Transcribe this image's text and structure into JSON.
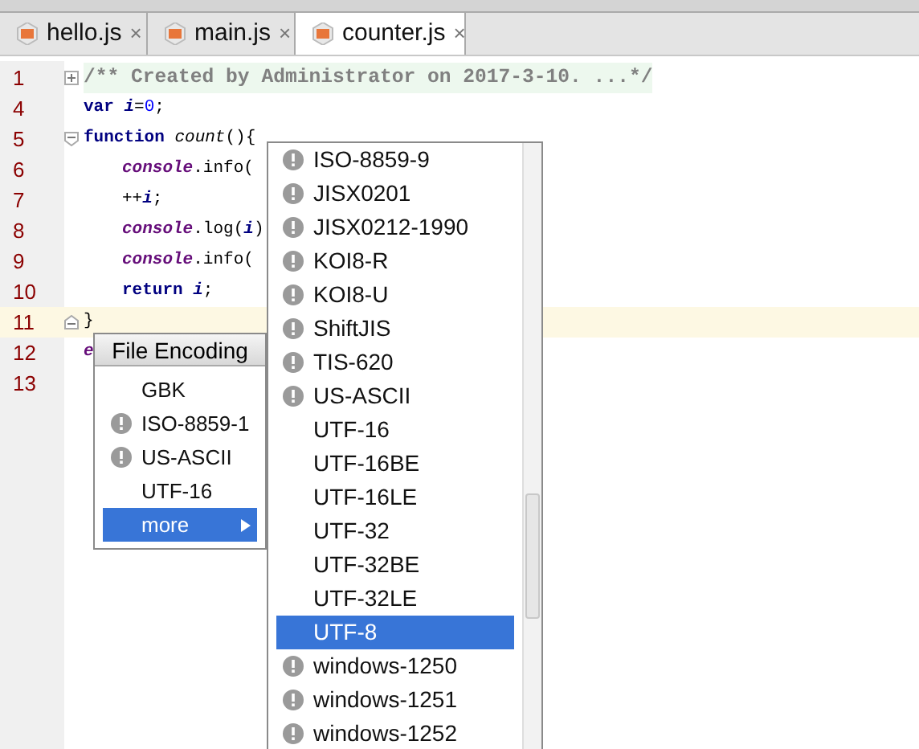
{
  "tabs": [
    {
      "label": "hello.js",
      "close": "×",
      "selected": false
    },
    {
      "label": "main.js",
      "close": "×",
      "selected": false
    },
    {
      "label": "counter.js",
      "close": "×",
      "selected": true
    }
  ],
  "code_lines": [
    {
      "number": "1",
      "kind": "fold-start",
      "highlighted": false,
      "tokens": [
        {
          "kind": "comment",
          "text": "/** Created by Administrator on 2017-3-10. ...*/"
        }
      ]
    },
    {
      "number": "4",
      "kind": "plain",
      "highlighted": false,
      "tokens": [
        {
          "kind": "keyword",
          "text": "var "
        },
        {
          "kind": "variable",
          "text": "i"
        },
        {
          "kind": "plain",
          "text": "="
        },
        {
          "kind": "number",
          "text": "0"
        },
        {
          "kind": "plain",
          "text": ";"
        }
      ]
    },
    {
      "number": "5",
      "kind": "fold-open",
      "highlighted": false,
      "tokens": [
        {
          "kind": "keyword",
          "text": "function "
        },
        {
          "kind": "function",
          "text": "count"
        },
        {
          "kind": "plain",
          "text": "(){"
        }
      ],
      "children": [
        {
          "number": "6",
          "kind": "plain",
          "highlighted": false,
          "tokens": [
            {
              "kind": "global",
              "text": "console"
            },
            {
              "kind": "plain",
              "text": ".info("
            }
          ]
        },
        {
          "number": "7",
          "kind": "plain",
          "highlighted": false,
          "tokens": [
            {
              "kind": "plain",
              "text": "++"
            },
            {
              "kind": "variable",
              "text": "i"
            },
            {
              "kind": "plain",
              "text": ";"
            }
          ]
        },
        {
          "number": "8",
          "kind": "plain",
          "highlighted": false,
          "tokens": [
            {
              "kind": "global",
              "text": "console"
            },
            {
              "kind": "plain",
              "text": ".log("
            },
            {
              "kind": "variable",
              "text": "i"
            },
            {
              "kind": "plain",
              "text": ")"
            }
          ]
        },
        {
          "number": "9",
          "kind": "plain",
          "highlighted": false,
          "tokens": [
            {
              "kind": "global",
              "text": "console"
            },
            {
              "kind": "plain",
              "text": ".info("
            }
          ]
        },
        {
          "number": "10",
          "kind": "plain",
          "highlighted": false,
          "tokens": [
            {
              "kind": "keyword",
              "text": "return "
            },
            {
              "kind": "variable",
              "text": "i"
            },
            {
              "kind": "plain",
              "text": ";"
            }
          ]
        }
      ]
    },
    {
      "number": "11",
      "kind": "fold-end",
      "highlighted": true,
      "tokens": [
        {
          "kind": "plain",
          "text": "}"
        }
      ]
    },
    {
      "number": "12",
      "kind": "plain",
      "highlighted": false,
      "tokens": [
        {
          "kind": "global",
          "text": "e"
        }
      ]
    },
    {
      "number": "13",
      "kind": "plain",
      "highlighted": false
    }
  ],
  "file_encoding_popup": {
    "title": "File Encoding",
    "items": [
      {
        "label": "GBK",
        "warning": false,
        "selected": false,
        "submenu": false
      },
      {
        "label": "ISO-8859-1",
        "warning": true,
        "selected": false,
        "submenu": false
      },
      {
        "label": "US-ASCII",
        "warning": true,
        "selected": false,
        "submenu": false
      },
      {
        "label": "UTF-16",
        "warning": false,
        "selected": false,
        "submenu": false
      },
      {
        "label": "more",
        "warning": false,
        "selected": true,
        "submenu": true
      }
    ]
  },
  "more_list": {
    "items": [
      {
        "label": "ISO-8859-9",
        "warning": true,
        "selected": false
      },
      {
        "label": "JISX0201",
        "warning": true,
        "selected": false
      },
      {
        "label": "JISX0212-1990",
        "warning": true,
        "selected": false
      },
      {
        "label": "KOI8-R",
        "warning": true,
        "selected": false
      },
      {
        "label": "KOI8-U",
        "warning": true,
        "selected": false
      },
      {
        "label": "ShiftJIS",
        "warning": true,
        "selected": false
      },
      {
        "label": "TIS-620",
        "warning": true,
        "selected": false
      },
      {
        "label": "US-ASCII",
        "warning": true,
        "selected": false
      },
      {
        "label": "UTF-16",
        "warning": false,
        "selected": false
      },
      {
        "label": "UTF-16BE",
        "warning": false,
        "selected": false
      },
      {
        "label": "UTF-16LE",
        "warning": false,
        "selected": false
      },
      {
        "label": "UTF-32",
        "warning": false,
        "selected": false
      },
      {
        "label": "UTF-32BE",
        "warning": false,
        "selected": false
      },
      {
        "label": "UTF-32LE",
        "warning": false,
        "selected": false
      },
      {
        "label": "UTF-8",
        "warning": false,
        "selected": true
      },
      {
        "label": "windows-1250",
        "warning": true,
        "selected": false
      },
      {
        "label": "windows-1251",
        "warning": true,
        "selected": false
      },
      {
        "label": "windows-1252",
        "warning": true,
        "selected": false
      }
    ]
  }
}
